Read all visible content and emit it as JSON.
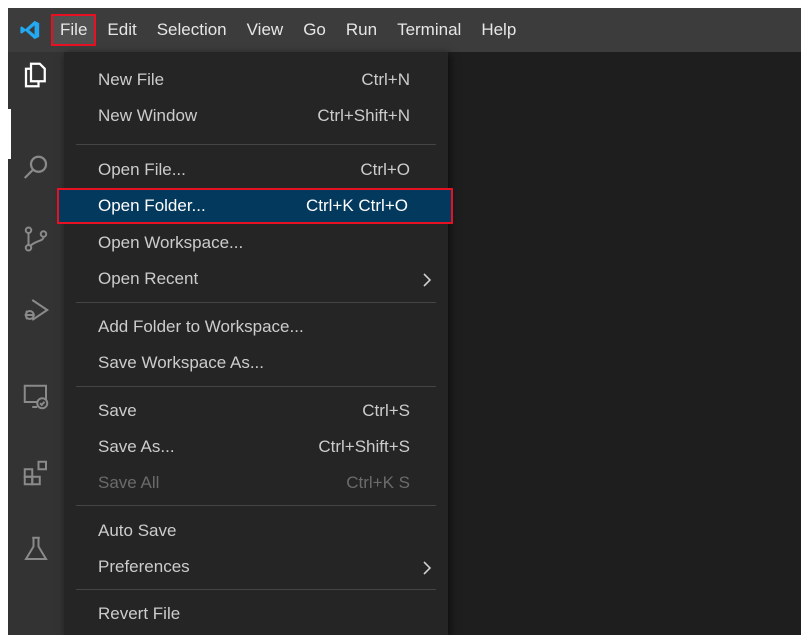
{
  "menubar": {
    "items": [
      {
        "label": "File"
      },
      {
        "label": "Edit"
      },
      {
        "label": "Selection"
      },
      {
        "label": "View"
      },
      {
        "label": "Go"
      },
      {
        "label": "Run"
      },
      {
        "label": "Terminal"
      },
      {
        "label": "Help"
      }
    ]
  },
  "activity_bar": {
    "icons": [
      "explorer-icon",
      "search-icon",
      "source-control-icon",
      "run-debug-icon",
      "remote-explorer-icon",
      "extensions-icon",
      "testing-icon"
    ]
  },
  "file_menu": {
    "items": [
      {
        "label": "New File",
        "shortcut": "Ctrl+N"
      },
      {
        "label": "New Window",
        "shortcut": "Ctrl+Shift+N"
      },
      {
        "label": "Open File...",
        "shortcut": "Ctrl+O"
      },
      {
        "label": "Open Folder...",
        "shortcut": "Ctrl+K Ctrl+O"
      },
      {
        "label": "Open Workspace..."
      },
      {
        "label": "Open Recent"
      },
      {
        "label": "Add Folder to Workspace..."
      },
      {
        "label": "Save Workspace As..."
      },
      {
        "label": "Save",
        "shortcut": "Ctrl+S"
      },
      {
        "label": "Save As...",
        "shortcut": "Ctrl+Shift+S"
      },
      {
        "label": "Save All",
        "shortcut": "Ctrl+K S"
      },
      {
        "label": "Auto Save"
      },
      {
        "label": "Preferences"
      },
      {
        "label": "Revert File"
      }
    ]
  },
  "colors": {
    "highlight": "#04395e",
    "annotation": "#e81123",
    "logo": "#23a9f2"
  }
}
